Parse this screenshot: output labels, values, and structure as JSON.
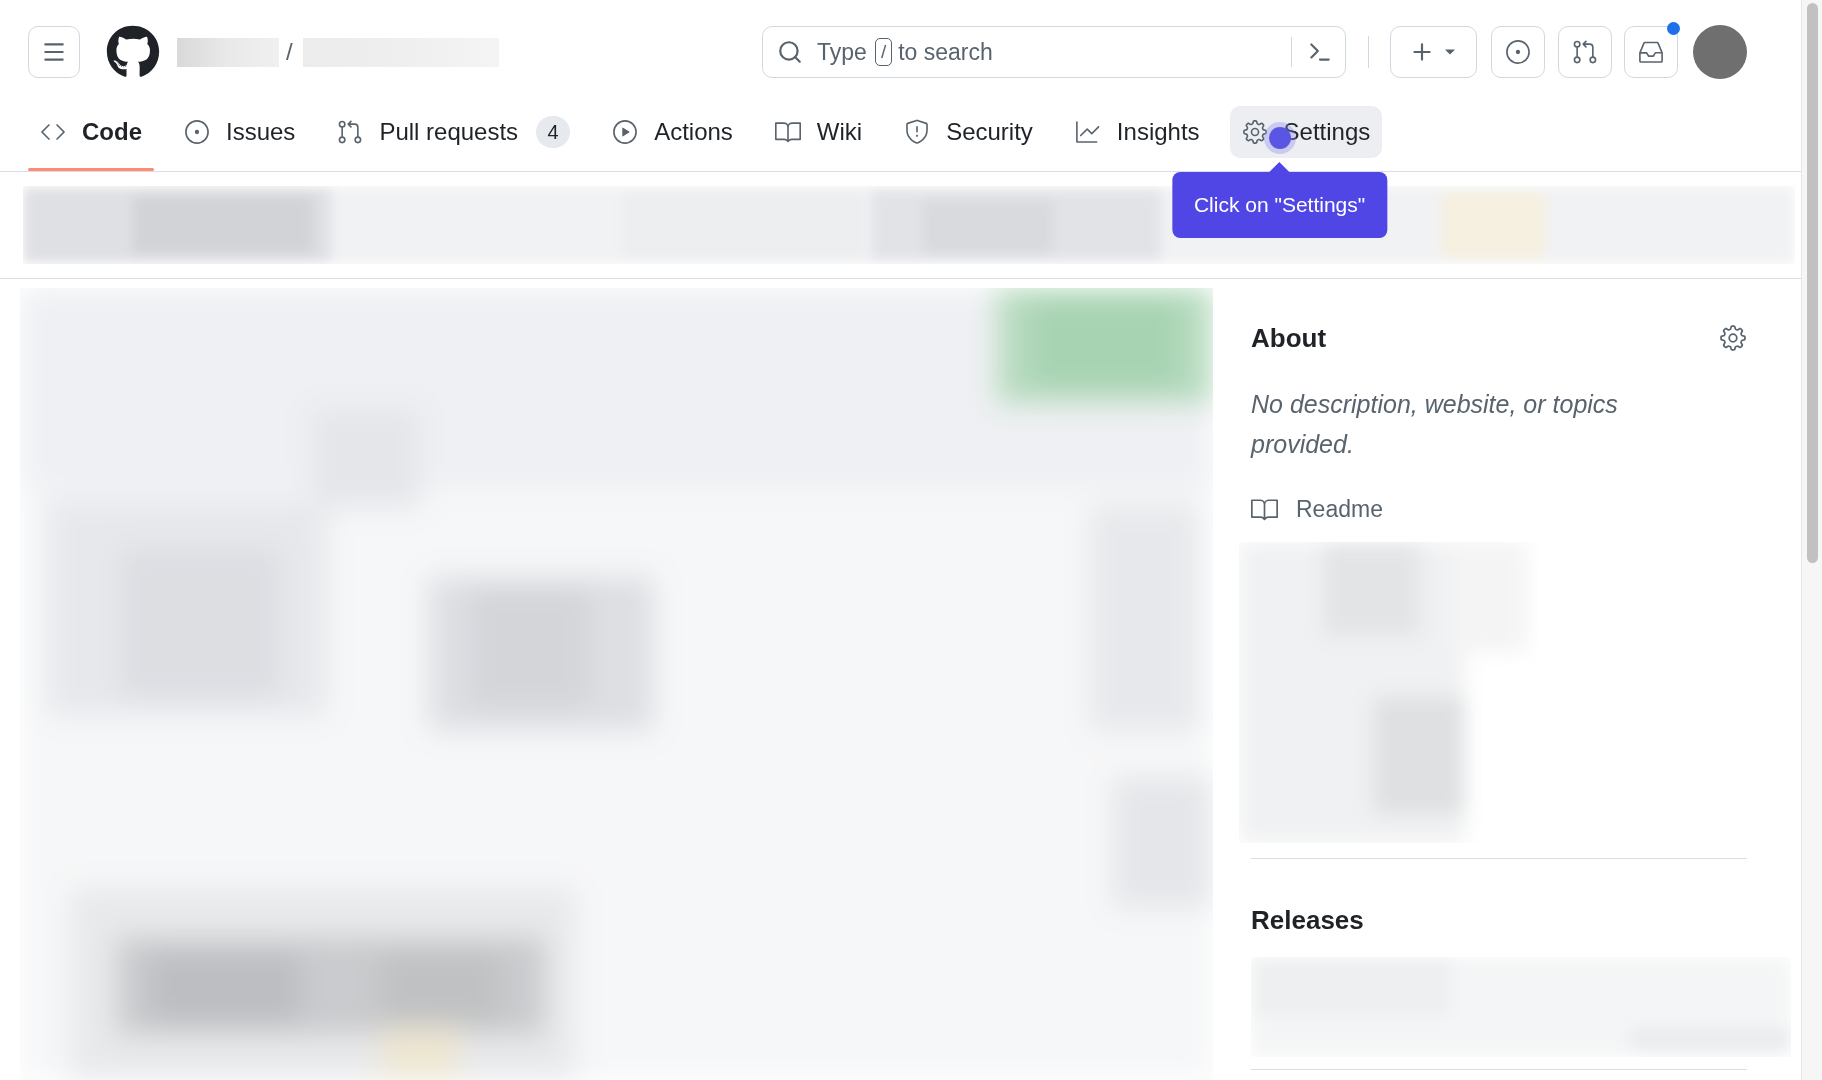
{
  "header": {
    "breadcrumb_separator": "/",
    "search": {
      "hint_start": "Type",
      "shortcut_key": "/",
      "hint_end": "to search"
    },
    "inbox": {
      "unread": true
    }
  },
  "tabs": [
    {
      "label": "Code",
      "selected": true,
      "hovered": false
    },
    {
      "label": "Issues",
      "selected": false,
      "hovered": false
    },
    {
      "label": "Pull requests",
      "counter": "4",
      "selected": false,
      "hovered": false
    },
    {
      "label": "Actions",
      "selected": false,
      "hovered": false
    },
    {
      "label": "Wiki",
      "selected": false,
      "hovered": false
    },
    {
      "label": "Security",
      "selected": false,
      "hovered": false
    },
    {
      "label": "Insights",
      "selected": false,
      "hovered": false
    },
    {
      "label": "Settings",
      "selected": false,
      "hovered": true,
      "tooltip": "Click on \"Settings\""
    }
  ],
  "sidebar": {
    "about": {
      "heading": "About",
      "description": "No description, website, or topics provided.",
      "links": [
        {
          "label": "Readme"
        }
      ]
    },
    "releases": {
      "heading": "Releases"
    }
  }
}
